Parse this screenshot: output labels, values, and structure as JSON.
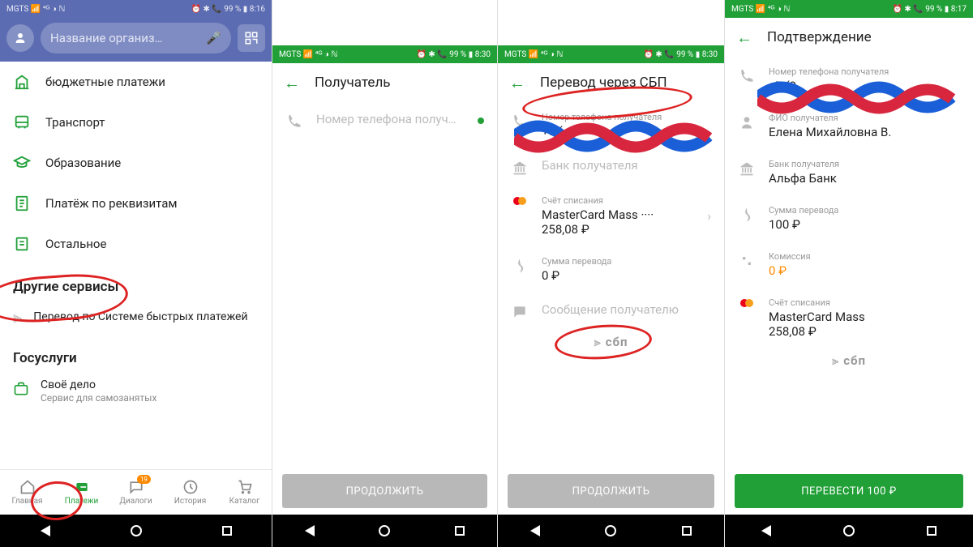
{
  "status": {
    "left": "MGTS 📶 ⁴ᴳ ◑ ℕ",
    "right1": "⏰ ✱ 📞 99 % ▮ 8:16",
    "right2": "⏰ ✱ 📞 99 % ▮ 8:30",
    "right3": "⏰ ✱ 📞 99 % ▮ 8:30",
    "right4": "⏰ ✱ 📞 99 % ▮ 8:17"
  },
  "s1": {
    "search_placeholder": "Название организ…",
    "categories": {
      "c0": "бюджетные платежи",
      "c1": "Транспорт",
      "c2": "Образование",
      "c3": "Платёж по реквизитам",
      "c4": "Остальное"
    },
    "other_services": "Другие сервисы",
    "sbp": "Перевод по Системе быстрых платежей",
    "gos": "Госуслуги",
    "svoe": "Своё дело",
    "svoe_sub": "Сервис для самозанятых",
    "tabs": {
      "t0": "Главная",
      "t1": "Платежи",
      "t2": "Диалоги",
      "t3": "История",
      "t4": "Каталог",
      "badge": "19"
    }
  },
  "s2": {
    "title": "Получатель",
    "phone_placeholder": "Номер телефона получ…",
    "cta": "ПРОДОЛЖИТЬ"
  },
  "s3": {
    "title": "Перевод через СБП",
    "phone_label": "Номер телефона получателя",
    "phone_value": "+7 (",
    "bank_label": "Банк получателя",
    "acct_label": "Счёт списания",
    "acct_card": "MasterCard Mass ····",
    "acct_balance": "258,08 ₽",
    "sum_label": "Сумма перевода",
    "sum_value": "0 ₽",
    "msg_label": "Сообщение получателю",
    "sbp": "сбп",
    "cta": "ПРОДОЛЖИТЬ"
  },
  "s4": {
    "title": "Подтверждение",
    "phone_label": "Номер телефона получателя",
    "phone_value": "+7 (9",
    "fio_label": "ФИО получателя",
    "fio_value": "Елена Михайловна В.",
    "bank_label": "Банк получателя",
    "bank_value": "Альфа Банк",
    "sum_label": "Сумма перевода",
    "sum_value": "100 ₽",
    "fee_label": "Комиссия",
    "fee_value": "0 ₽",
    "acct_label": "Счёт списания",
    "acct_card": "MasterCard Mass",
    "acct_balance": "258,08 ₽",
    "sbp": "сбп",
    "cta": "ПЕРЕВЕСТИ 100 ₽"
  }
}
